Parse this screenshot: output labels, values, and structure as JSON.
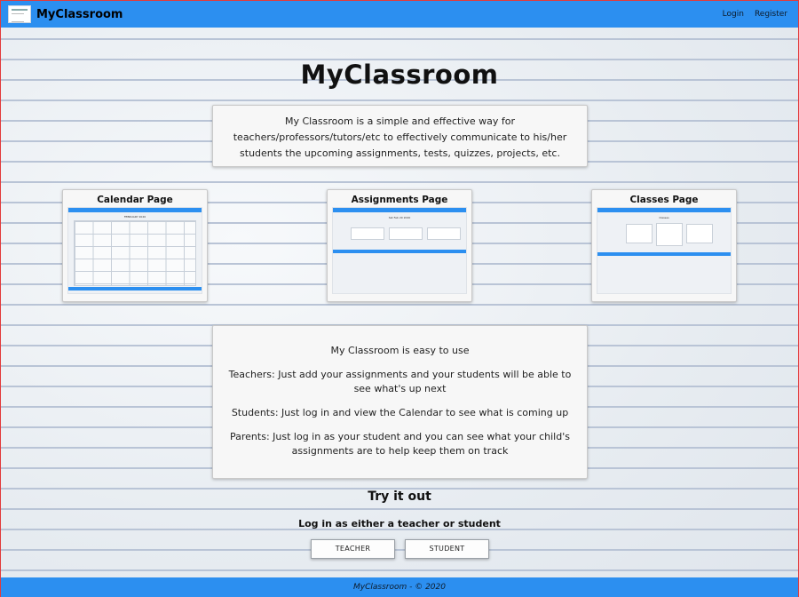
{
  "navbar": {
    "brand": "MyClassroom",
    "links": [
      "Login",
      "Register"
    ]
  },
  "hero": {
    "title": "MyClassroom",
    "intro": "My Classroom is a simple and effective way for teachers/professors/tutors/etc to effectively communicate to his/her students the upcoming assignments, tests, quizzes, projects, etc."
  },
  "cards": [
    {
      "title": "Calendar Page",
      "thumb_heading": "FEBRUARY 2020"
    },
    {
      "title": "Assignments Page",
      "thumb_heading": "Sat Feb 29 2020"
    },
    {
      "title": "Classes Page",
      "thumb_heading": "Classes"
    }
  ],
  "usage": {
    "heading": "My Classroom is easy to use",
    "teachers": "Teachers: Just add your assignments and your students will be able to see what's up next",
    "students": "Students: Just log in and view the Calendar to see what is coming up",
    "parents": "Parents: Just log in as your student and you can see what your child's assignments are to help keep them on track"
  },
  "try_it": {
    "title": "Try it out",
    "subtitle": "Log in as either a teacher or student",
    "teacher_button": "TEACHER",
    "student_button": "STUDENT"
  },
  "footer": {
    "text": "MyClassroom - © 2020"
  },
  "colors": {
    "accent": "#2c8ff0",
    "panel": "#f7f7f7"
  }
}
